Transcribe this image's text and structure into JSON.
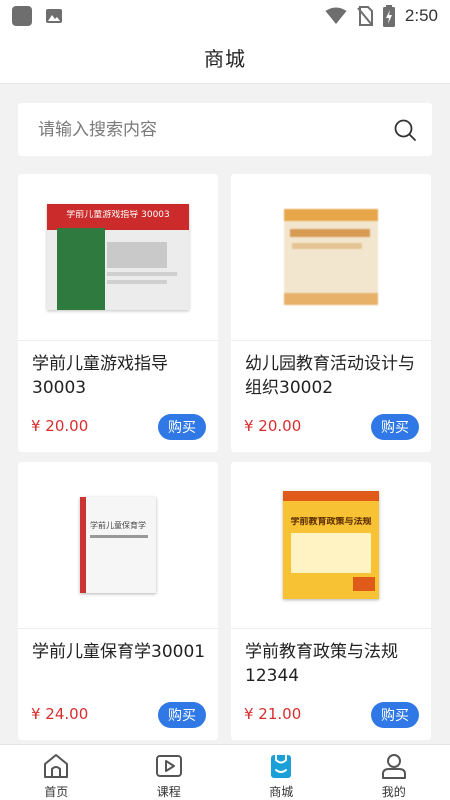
{
  "status_bar": {
    "time": "2:50"
  },
  "header": {
    "title": "商城"
  },
  "search": {
    "placeholder": "请输入搜索内容"
  },
  "products": [
    {
      "title": "学前儿童游戏指导30003",
      "price": "¥ 20.00",
      "buy_label": "购买",
      "cover_text": "学前儿童游戏指导 30003"
    },
    {
      "title": "幼儿园教育活动设计与组织30002",
      "price": "¥ 20.00",
      "buy_label": "购买",
      "cover_text": ""
    },
    {
      "title": "学前儿童保育学30001",
      "price": "¥ 24.00",
      "buy_label": "购买",
      "cover_text": "学前儿童保育学"
    },
    {
      "title": "学前教育政策与法规12344",
      "price": "¥ 21.00",
      "buy_label": "购买",
      "cover_text": "学前教育政策与法规"
    }
  ],
  "tabbar": {
    "active": "商城",
    "items": [
      {
        "label": "首页",
        "icon": "home-icon"
      },
      {
        "label": "课程",
        "icon": "video-icon"
      },
      {
        "label": "商城",
        "icon": "bag-icon"
      },
      {
        "label": "我的",
        "icon": "user-icon"
      }
    ]
  },
  "colors": {
    "accent": "#2f78e6",
    "price": "#d92d2d",
    "active_tab": "#1aa0d6",
    "background": "#f2f2f2"
  }
}
